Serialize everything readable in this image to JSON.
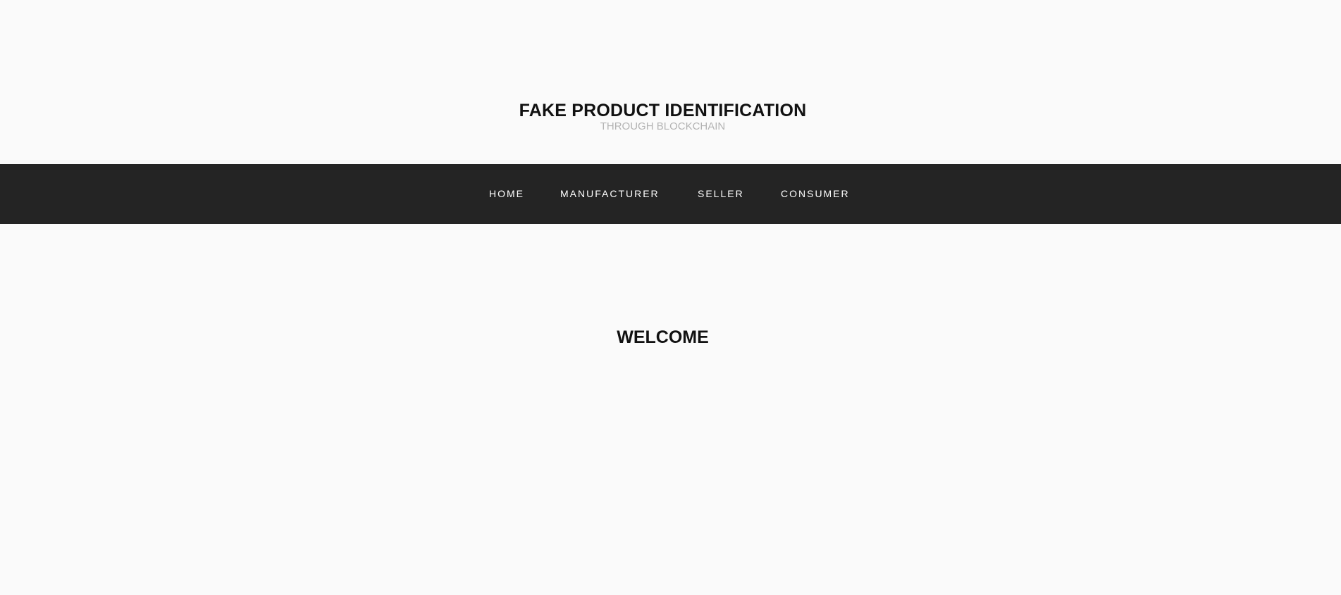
{
  "header": {
    "title": "FAKE PRODUCT IDENTIFICATION",
    "subtitle": "THROUGH BLOCKCHAIN"
  },
  "nav": {
    "items": [
      {
        "label": "HOME"
      },
      {
        "label": "MANUFACTURER"
      },
      {
        "label": "SELLER"
      },
      {
        "label": "CONSUMER"
      }
    ]
  },
  "main": {
    "heading": "WELCOME"
  },
  "colors": {
    "background": "#fafafa",
    "navbar": "#242424",
    "nav_text": "#ffffff",
    "title_text": "#111111",
    "subtitle_text": "#b3b3b3"
  }
}
